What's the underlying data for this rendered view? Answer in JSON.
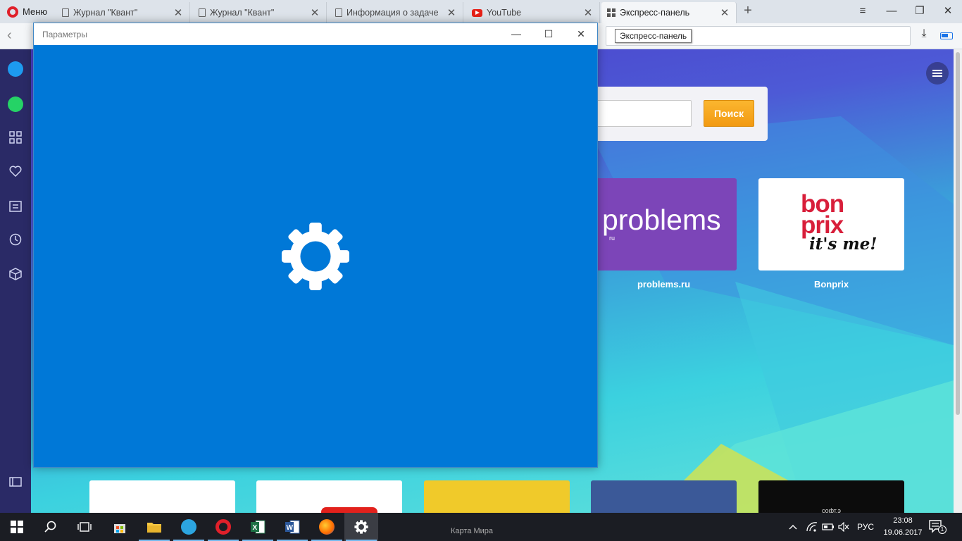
{
  "browser": {
    "menu_label": "Меню",
    "tabs": [
      {
        "label": "Журнал \"Квант\"",
        "icon": "document-icon"
      },
      {
        "label": "Журнал \"Квант\"",
        "icon": "document-icon"
      },
      {
        "label": "Информация о задаче",
        "icon": "document-icon"
      },
      {
        "label": "YouTube",
        "icon": "youtube-icon"
      },
      {
        "label": "Экспресс-панель",
        "icon": "speed-dial-icon",
        "active": true
      }
    ],
    "tooltip": "Экспресс-панель"
  },
  "speed_dial": {
    "search_button_label": "Поиск",
    "tiles": [
      {
        "caption": "problems.ru",
        "logo_text": "problems",
        "logo_sub": "ru"
      },
      {
        "caption": "Bonprix",
        "logo_line1": "bon",
        "logo_line2": "prix",
        "logo_line3": "it's me!"
      }
    ],
    "bottom_tile_text": "софт.э"
  },
  "settings_window": {
    "title": "Параметры",
    "background_color": "#0078d7"
  },
  "taskbar": {
    "background_label": "Карта Мира",
    "language": "РУС",
    "time": "23:08",
    "date": "19.06.2017",
    "notification_count": "1"
  },
  "colors": {
    "opera_red": "#e0202a",
    "accent_blue": "#0078d7",
    "search_button": "#f5a623"
  }
}
